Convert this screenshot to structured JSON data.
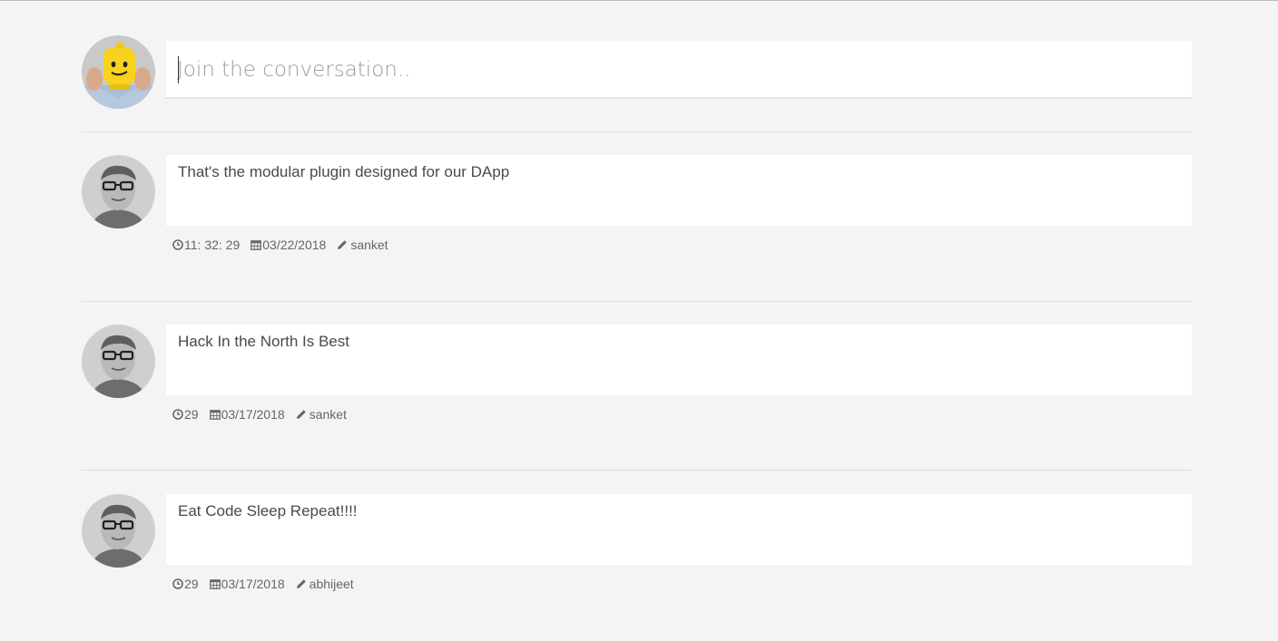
{
  "composer": {
    "placeholder": "Join the conversation..",
    "avatar_icon": "lego-head-avatar"
  },
  "posts": [
    {
      "text": "That's the modular plugin designed for our DApp",
      "time": "11: 32: 29",
      "date": "03/22/2018",
      "author": "sanket"
    },
    {
      "text": "Hack In the North Is Best",
      "time": "29",
      "date": "03/17/2018",
      "author": "sanket"
    },
    {
      "text": "Eat Code Sleep Repeat!!!!",
      "time": "29",
      "date": "03/17/2018",
      "author": "abhijeet"
    }
  ],
  "icons": {
    "time": "clock-icon",
    "date": "calendar-icon",
    "author": "pencil-icon"
  },
  "colors": {
    "background": "#f4f4f4",
    "card": "#ffffff",
    "text": "#4a4a4a",
    "meta": "#666666"
  }
}
